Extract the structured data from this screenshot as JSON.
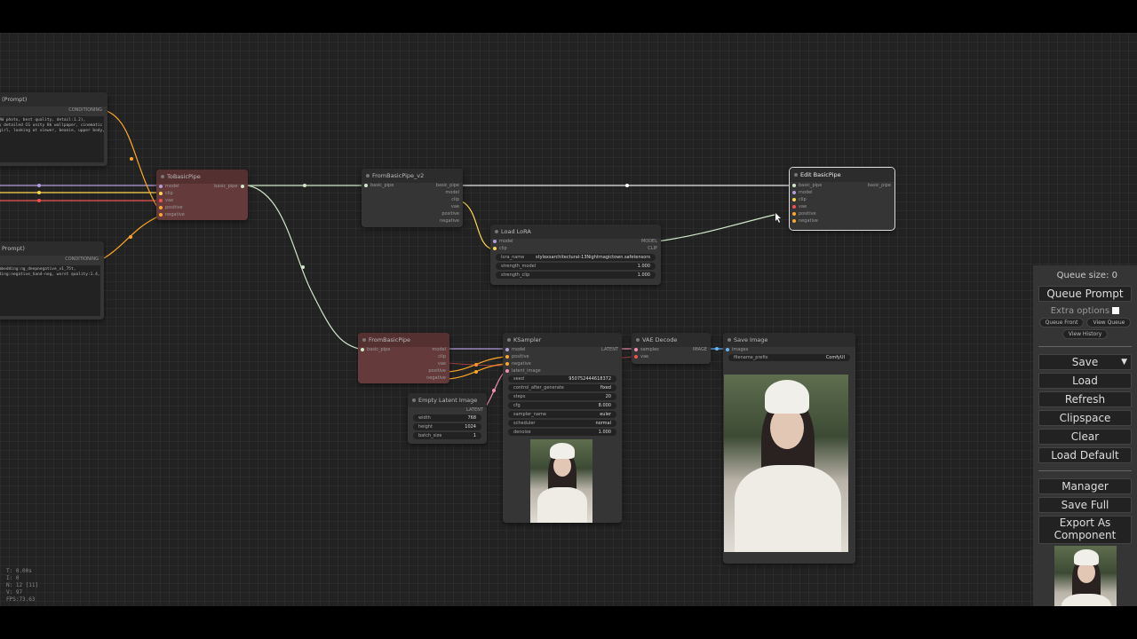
{
  "canvas_nodes": {
    "prompt_positive": {
      "title": "(Prompt)",
      "output": "CONDITIONING",
      "text": "RAW photo, best quality, detail:1.2),\nly detailed CG unity 8k wallpaper, cinematic\n1girl, looking at viewer, beanie, upper body,"
    },
    "prompt_negative": {
      "title": "Prompt)",
      "output": "CONDITIONING",
      "text": "embedding:ng_deepnegative_v1_75t,\ndding:negative_hand-neg, worst quality:1.4, low\nr"
    },
    "to_basic_pipe": {
      "title": "ToBasicPipe",
      "inputs": [
        "model",
        "clip",
        "vae",
        "positive",
        "negative"
      ],
      "output": "basic_pipe"
    },
    "from_basic_pipe_v2": {
      "title": "FromBasicPipe_v2",
      "input": "basic_pipe",
      "outputs": [
        "basic_pipe",
        "model",
        "clip",
        "vae",
        "positive",
        "negative"
      ]
    },
    "load_lora": {
      "title": "Load LoRA",
      "inputs": [
        "model",
        "clip"
      ],
      "outputs": [
        "MODEL",
        "CLIP"
      ],
      "widgets": [
        {
          "label": "lora_name",
          "value": "stylexsarchitectural-13Nightmagictown.safetensors"
        },
        {
          "label": "strength_model",
          "value": "1.000"
        },
        {
          "label": "strength_clip",
          "value": "1.000"
        }
      ]
    },
    "edit_basic_pipe": {
      "title": "Edit BasicPipe",
      "inputs": [
        "basic_pipe",
        "model",
        "clip",
        "vae",
        "positive",
        "negative"
      ],
      "output": "basic_pipe"
    },
    "from_basic_pipe": {
      "title": "FromBasicPipe",
      "input": "basic_pipe",
      "outputs": [
        "model",
        "clip",
        "vae",
        "positive",
        "negative"
      ]
    },
    "ksampler": {
      "title": "KSampler",
      "inputs": [
        "model",
        "positive",
        "negative",
        "latent_image"
      ],
      "output": "LATENT",
      "widgets": [
        {
          "label": "seed",
          "value": "950752444618372"
        },
        {
          "label": "control_after_generate",
          "value": "fixed"
        },
        {
          "label": "steps",
          "value": "20"
        },
        {
          "label": "cfg",
          "value": "8.000"
        },
        {
          "label": "sampler_name",
          "value": "euler"
        },
        {
          "label": "scheduler",
          "value": "normal"
        },
        {
          "label": "denoise",
          "value": "1.000"
        }
      ]
    },
    "empty_latent": {
      "title": "Empty Latent Image",
      "output": "LATENT",
      "widgets": [
        {
          "label": "width",
          "value": "768"
        },
        {
          "label": "height",
          "value": "1024"
        },
        {
          "label": "batch_size",
          "value": "1"
        }
      ]
    },
    "vae_decode": {
      "title": "VAE Decode",
      "inputs": [
        "samples",
        "vae"
      ],
      "output": "IMAGE"
    },
    "save_image": {
      "title": "Save Image",
      "input": "images",
      "widgets": [
        {
          "label": "filename_prefix",
          "value": "ComfyUI"
        }
      ]
    }
  },
  "stats": {
    "t": "T: 0.00s",
    "i": "I: 0",
    "n": "N: 12 [11]",
    "v": "V: 97",
    "fps": "FPS:73.63"
  },
  "menu": {
    "queue_size": "Queue size: 0",
    "queue_prompt": "Queue Prompt",
    "extra_options": "Extra options",
    "queue_front": "Queue Front",
    "view_queue": "View Queue",
    "view_history": "View History",
    "save": "Save",
    "load": "Load",
    "refresh": "Refresh",
    "clipspace": "Clipspace",
    "clear": "Clear",
    "load_default": "Load Default",
    "manager": "Manager",
    "save_full": "Save Full",
    "export_component": "Export As Component"
  },
  "colors": {
    "model": "#b39ddb",
    "clip": "#ffd54f",
    "vae": "#ef5350",
    "conditioning": "#ffa726",
    "latent": "#f48fb1",
    "image": "#64b5f6",
    "basic_pipe": "#cfe8c8"
  }
}
